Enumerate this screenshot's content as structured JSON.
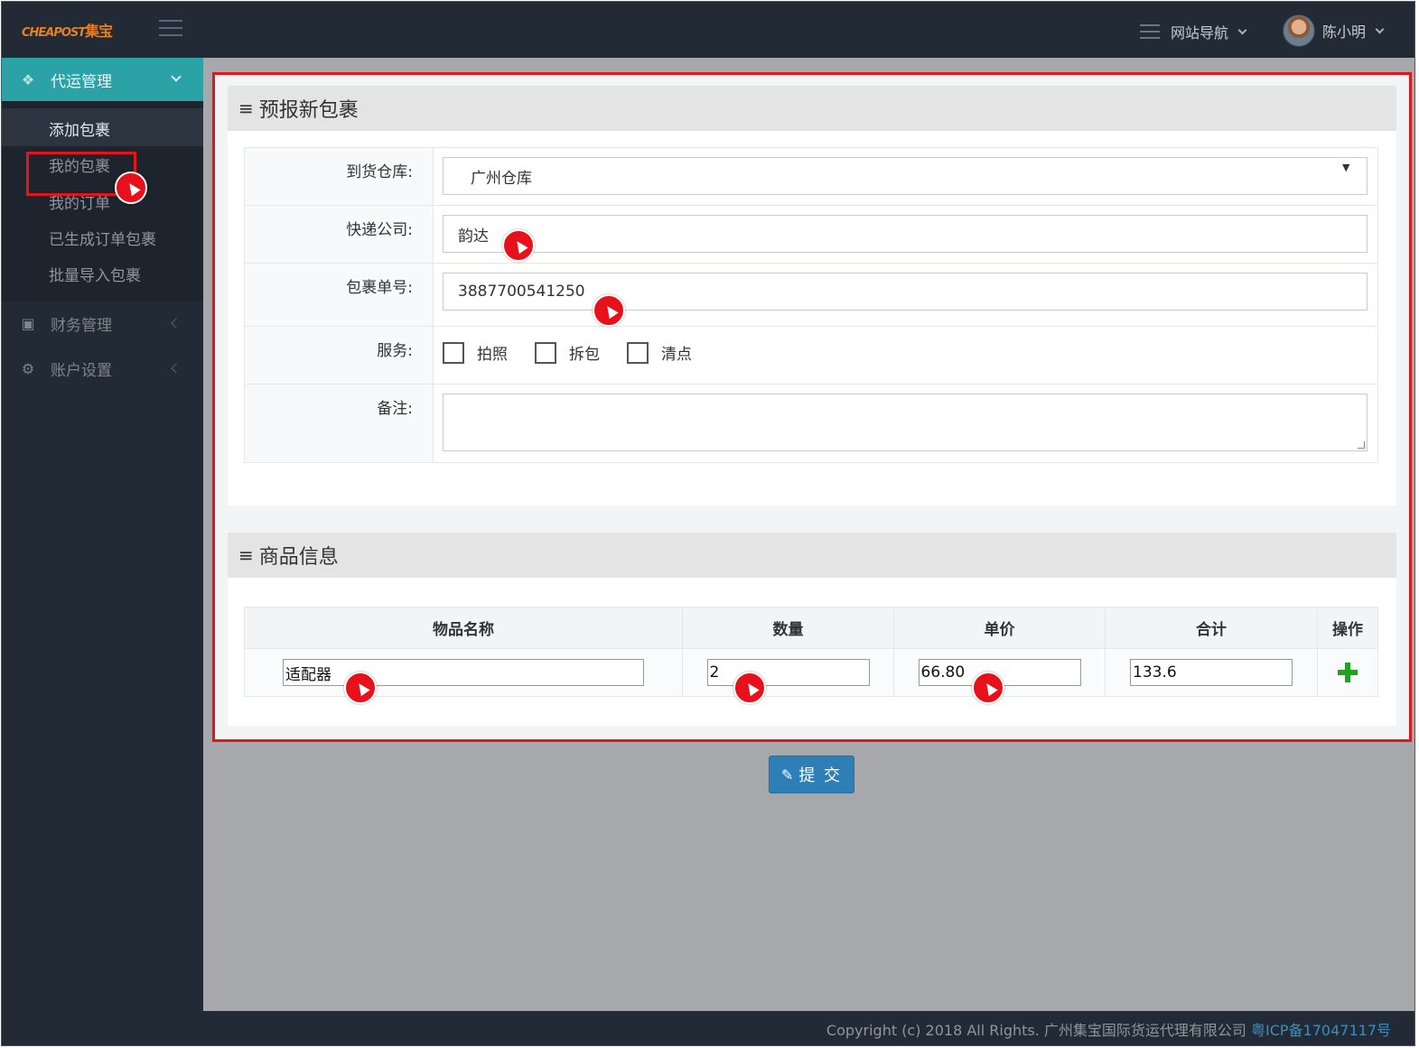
{
  "header": {
    "logo_en": "CHEAPOST",
    "logo_cn": "集宝",
    "nav_label": "网站导航",
    "user_name": "陈小明"
  },
  "sidebar": {
    "sections": [
      {
        "label": "代运管理",
        "icon": "cubes-icon",
        "expanded": true
      },
      {
        "label": "财务管理",
        "icon": "money-icon",
        "expanded": false
      },
      {
        "label": "账户设置",
        "icon": "gear-icon",
        "expanded": false
      }
    ],
    "sub_items": [
      {
        "label": "添加包裹",
        "active": true
      },
      {
        "label": "我的包裹"
      },
      {
        "label": "我的订单"
      },
      {
        "label": "已生成订单包裹"
      },
      {
        "label": "批量导入包裹"
      }
    ]
  },
  "form": {
    "title": "预报新包裹",
    "warehouse_label": "到货仓库:",
    "warehouse_value": "广州仓库",
    "courier_label": "快递公司:",
    "courier_value": "韵达",
    "tracking_label": "包裹单号:",
    "tracking_value": "3887700541250",
    "service_label": "服务:",
    "services": [
      "拍照",
      "拆包",
      "清点"
    ],
    "note_label": "备注:"
  },
  "goods": {
    "title": "商品信息",
    "columns": [
      "物品名称",
      "数量",
      "单价",
      "合计",
      "操作"
    ],
    "rows": [
      {
        "name": "适配器",
        "qty": "2",
        "price": "66.80",
        "total": "133.6"
      }
    ]
  },
  "submit_label": "提 交",
  "footer": {
    "copyright": "Copyright (c) 2018 All Rights. 广州集宝国际货运代理有限公司 ",
    "icp": "粤ICP备17047117号"
  },
  "colors": {
    "sidebar_bg": "#222a35",
    "active_teal": "#2ba2a6",
    "highlight_red": "#e3151a",
    "submit_blue": "#2f7fb7",
    "add_green": "#1ca51c"
  }
}
